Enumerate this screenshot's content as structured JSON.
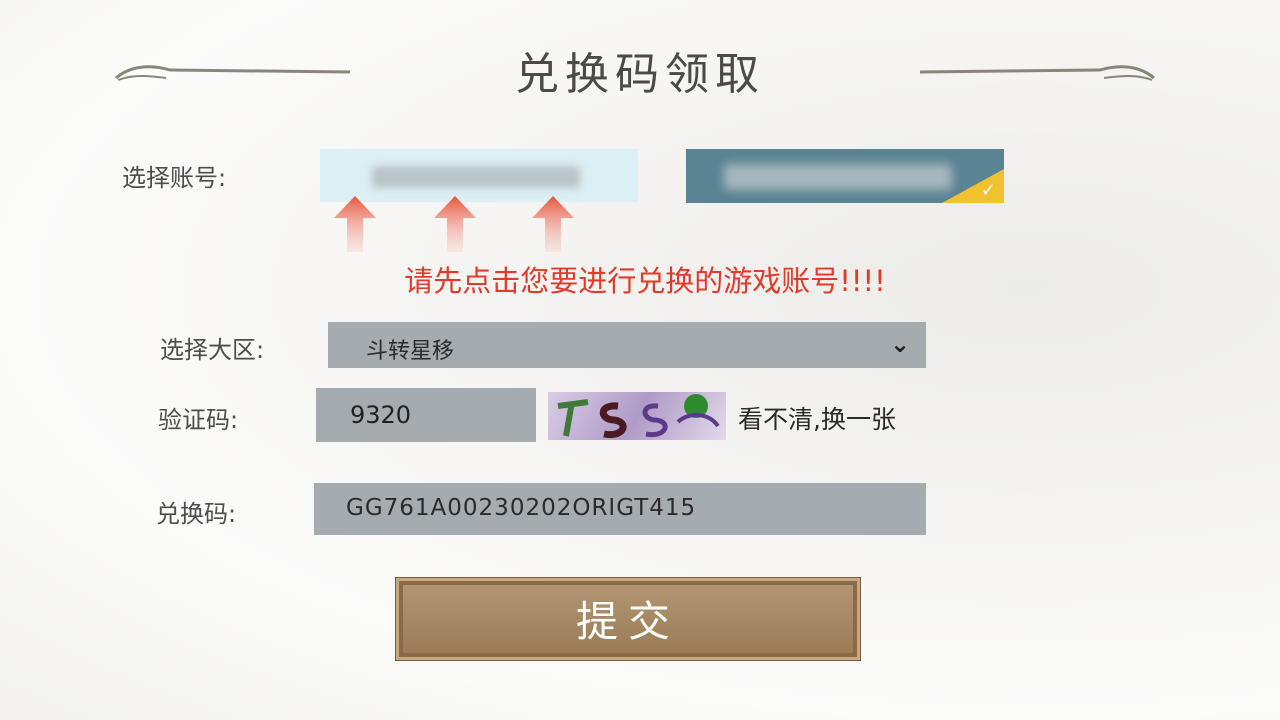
{
  "header": {
    "title": "兑换码领取"
  },
  "account": {
    "label": "选择账号:",
    "warning": "请先点击您要进行兑换的游戏账号!!!!"
  },
  "server": {
    "label": "选择大区:",
    "selected": "斗转星移"
  },
  "captcha": {
    "label": "验证码:",
    "value": "9320",
    "refresh_label": "看不清,换一张"
  },
  "redeem": {
    "label": "兑换码:",
    "value": "GG761A00230202ORIGT415"
  },
  "submit_label": "提交",
  "colors": {
    "warning": "#e23a2a",
    "selected_account": "#5a8393",
    "check_badge": "#f2c12e",
    "input_bg": "#a6abb0"
  },
  "icons": {
    "arrow": "up-arrow-icon",
    "select": "chevron-down-icon",
    "check": "check-icon"
  }
}
